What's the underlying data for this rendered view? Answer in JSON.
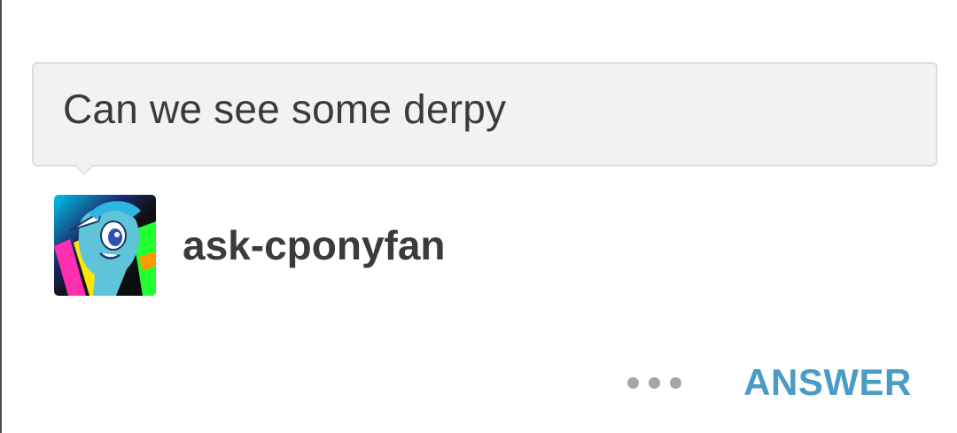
{
  "ask": {
    "question": "Can we see some derpy",
    "asker": {
      "username": "ask-cponyfan",
      "avatar_icon": "pony-avatar-icon"
    }
  },
  "actions": {
    "more_icon": "more-options-icon",
    "answer_label": "ANSWER"
  },
  "colors": {
    "accent": "#4b9bc7",
    "bubble_bg": "#f2f2f2",
    "text": "#3a3a3a"
  }
}
